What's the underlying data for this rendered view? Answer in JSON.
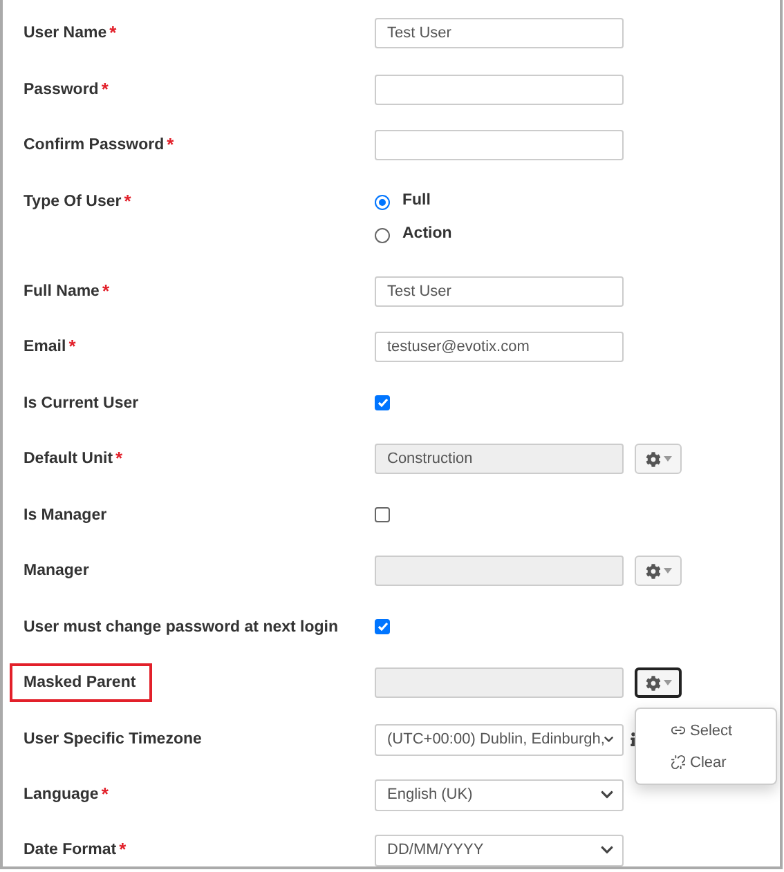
{
  "fields": [
    {
      "kind": "text",
      "label": "User Name",
      "required_mark": "*",
      "value": "Test User"
    },
    {
      "kind": "text",
      "label": "Password",
      "required_mark": "*"
    },
    {
      "kind": "text",
      "label": "Confirm Password",
      "required_mark": "*"
    },
    {
      "kind": "radio",
      "label": "Type Of User",
      "required_mark": "*",
      "options": [
        {
          "label": "Full",
          "selected": true
        },
        {
          "label": "Action",
          "selected": false
        }
      ]
    },
    {
      "kind": "text",
      "label": "Full Name",
      "required_mark": "*",
      "value": "Test User"
    },
    {
      "kind": "text",
      "label": "Email",
      "required_mark": "*",
      "value": "testuser@evotix.com"
    },
    {
      "kind": "checkbox",
      "label": "Is Current User",
      "checked": true
    },
    {
      "kind": "lookup",
      "label": "Default Unit",
      "required_mark": "*",
      "value": "Construction",
      "highlighted": false,
      "menu_open": false
    },
    {
      "kind": "checkbox",
      "label": "Is Manager",
      "checked": false
    },
    {
      "kind": "lookup",
      "label": "Manager",
      "highlighted": false,
      "menu_open": false
    },
    {
      "kind": "checkbox",
      "label": "User must change password at next login",
      "checked": true
    },
    {
      "kind": "lookup",
      "label": "Masked Parent",
      "highlighted": true,
      "menu_open": true,
      "menu": [
        {
          "kind": "select",
          "label": "Select"
        },
        {
          "kind": "clear",
          "label": "Clear"
        }
      ]
    },
    {
      "kind": "select",
      "label": "User Specific Timezone",
      "value": "(UTC+00:00) Dublin, Edinburgh,",
      "info": true
    },
    {
      "kind": "select",
      "label": "Language",
      "required_mark": "*",
      "value": "English (UK)"
    },
    {
      "kind": "select",
      "label": "Date Format",
      "required_mark": "*",
      "value": "DD/MM/YYYY"
    }
  ]
}
